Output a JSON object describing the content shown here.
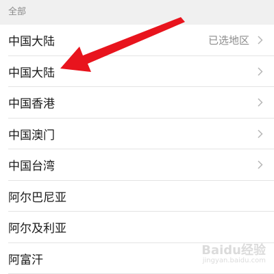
{
  "section": {
    "title": "全部"
  },
  "regions": [
    {
      "name": "中国大陆",
      "status": "已选地区"
    },
    {
      "name": "中国大陆",
      "status": ""
    },
    {
      "name": "中国香港",
      "status": ""
    },
    {
      "name": "中国澳门",
      "status": ""
    },
    {
      "name": "中国台湾",
      "status": ""
    },
    {
      "name": "阿尔巴尼亚",
      "status": ""
    },
    {
      "name": "阿尔及利亚",
      "status": ""
    },
    {
      "name": "阿富汗",
      "status": ""
    }
  ],
  "icons": {
    "chevron": "chevron-right-icon",
    "annotation": "red-arrow-annotation"
  },
  "colors": {
    "section_bg": "#f0f0f0",
    "arrow": "#e8141d",
    "text": "#1a1a1a",
    "muted": "#8c8c8c"
  },
  "watermark": {
    "text": "Baidu经验",
    "subtext": "jingyan.baidu.com"
  }
}
